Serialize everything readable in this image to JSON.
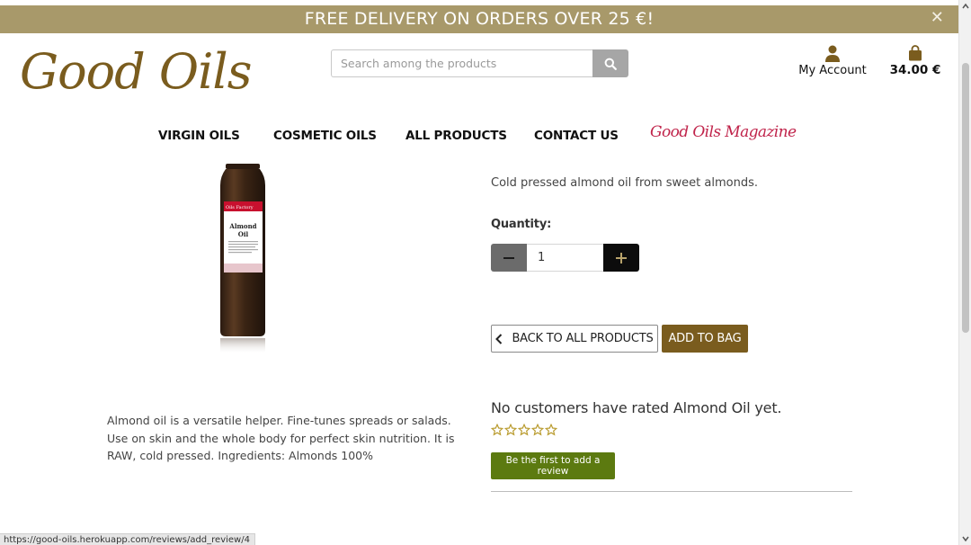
{
  "banner": {
    "text": "FREE DELIVERY ON ORDERS OVER 25 €!",
    "close_icon": "close-icon"
  },
  "header": {
    "logo_text": "Good Oils",
    "search_placeholder": "Search among the products",
    "search_icon": "search-icon",
    "account_label": "My Account",
    "account_icon": "user-icon",
    "bag_total": "34.00 €",
    "bag_icon": "shopping-bag-icon"
  },
  "nav": {
    "items": [
      "VIRGIN OILS",
      "COSMETIC OILS",
      "ALL PRODUCTS",
      "CONTACT US"
    ],
    "magazine": "Good Oils Magazine"
  },
  "product": {
    "image_label_brand": "Oils Factory",
    "image_label_name_line1": "Almond",
    "image_label_name_line2": "Oil",
    "short_description": "Cold pressed almond oil from sweet almonds.",
    "quantity_label": "Quantity:",
    "quantity_value": "1",
    "back_label": "BACK TO ALL PRODUCTS",
    "add_label": "ADD TO BAG",
    "long_description": "Almond oil is a versatile helper. Fine-tunes spreads or salads. Use on skin and the whole body for perfect skin nutrition. It is RAW, cold pressed. Ingredients: Almonds 100%"
  },
  "reviews": {
    "title": "No customers have rated Almond Oil yet.",
    "stars_filled": 0,
    "stars_total": 5,
    "review_button": "Be the first to add a review"
  },
  "status_url": "https://good-oils.herokuapp.com/reviews/add_review/4",
  "colors": {
    "banner": "#a8996a",
    "brand": "#7a5c1e",
    "review_button": "#5c7a10",
    "magazine": "#c0234a",
    "stars": "#b89a2c"
  }
}
